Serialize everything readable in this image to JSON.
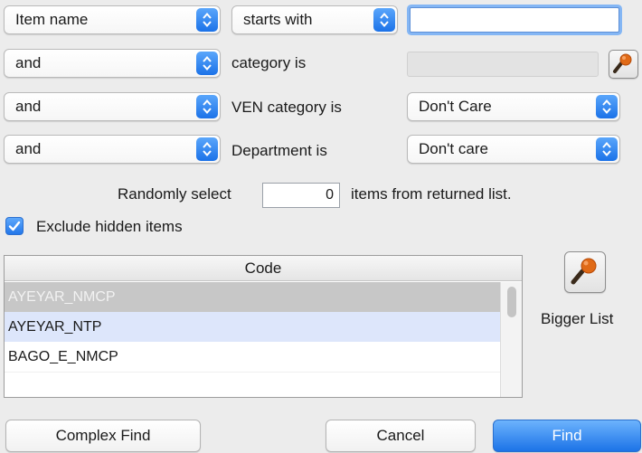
{
  "criteria": [
    {
      "conjunction": "Item name",
      "field_label": "starts with",
      "value": ""
    },
    {
      "conjunction": "and",
      "field_label": "category is",
      "value": ""
    },
    {
      "conjunction": "and",
      "field_label": "VEN category is",
      "value": "Don't Care"
    },
    {
      "conjunction": "and",
      "field_label": "Department is",
      "value": "Don't care"
    }
  ],
  "random": {
    "prefix": "Randomly select",
    "count": "0",
    "suffix": "items from returned list."
  },
  "exclude_hidden": {
    "label": "Exclude hidden items",
    "checked": true
  },
  "table": {
    "column": "Code",
    "rows": [
      "AYEYAR_NMCP",
      "AYEYAR_NTP",
      "BAGO_E_NMCP"
    ]
  },
  "bigger_list": {
    "label": "Bigger List",
    "icon": "magnifier-icon"
  },
  "buttons": {
    "complex_find": "Complex Find",
    "cancel": "Cancel",
    "find": "Find"
  },
  "colors": {
    "accent": "#1c73e7",
    "selected_row": "#c7c7c7",
    "highlight_row": "#dde6fb",
    "selected_text": "#f2f2f2"
  }
}
